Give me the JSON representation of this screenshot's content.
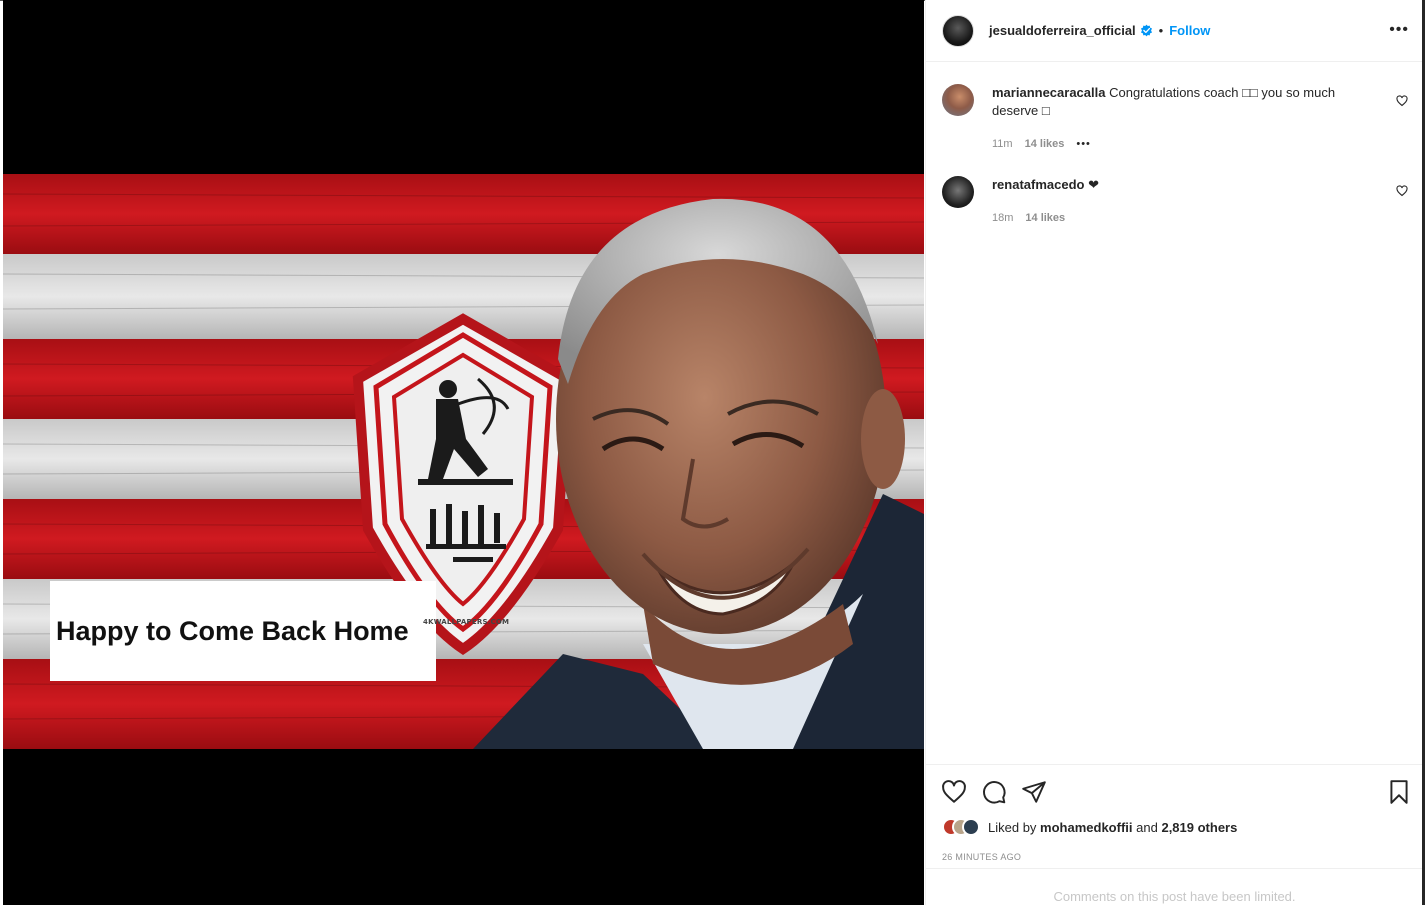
{
  "post": {
    "image_caption": "Happy to Come Back Home",
    "watermark": "4KWALLPAPERS.COM"
  },
  "header": {
    "username": "jesualdoferreira_official",
    "separator": "•",
    "follow_label": "Follow",
    "more_label": "•••"
  },
  "comments": [
    {
      "username": "mariannecaracalla",
      "text": "Congratulations coach □□ you so much deserve □",
      "time": "11m",
      "likes": "14 likes",
      "options": "•••"
    },
    {
      "username": "renatafmacedo",
      "text": "❤",
      "time": "18m",
      "likes": "14 likes"
    }
  ],
  "likes": {
    "prefix": "Liked by",
    "user": "mohamedkoffii",
    "conjunction": "and",
    "others": "2,819 others"
  },
  "timestamp": "26 MINUTES AGO",
  "comments_limited": "Comments on this post have been limited.",
  "colors": {
    "link_blue": "#0095f6",
    "stripe_red": "#c4151b",
    "muted": "#8e8e8e"
  },
  "icons": [
    "verified-badge-icon",
    "more-options-icon",
    "heart-icon",
    "comment-icon",
    "share-icon",
    "bookmark-icon"
  ]
}
